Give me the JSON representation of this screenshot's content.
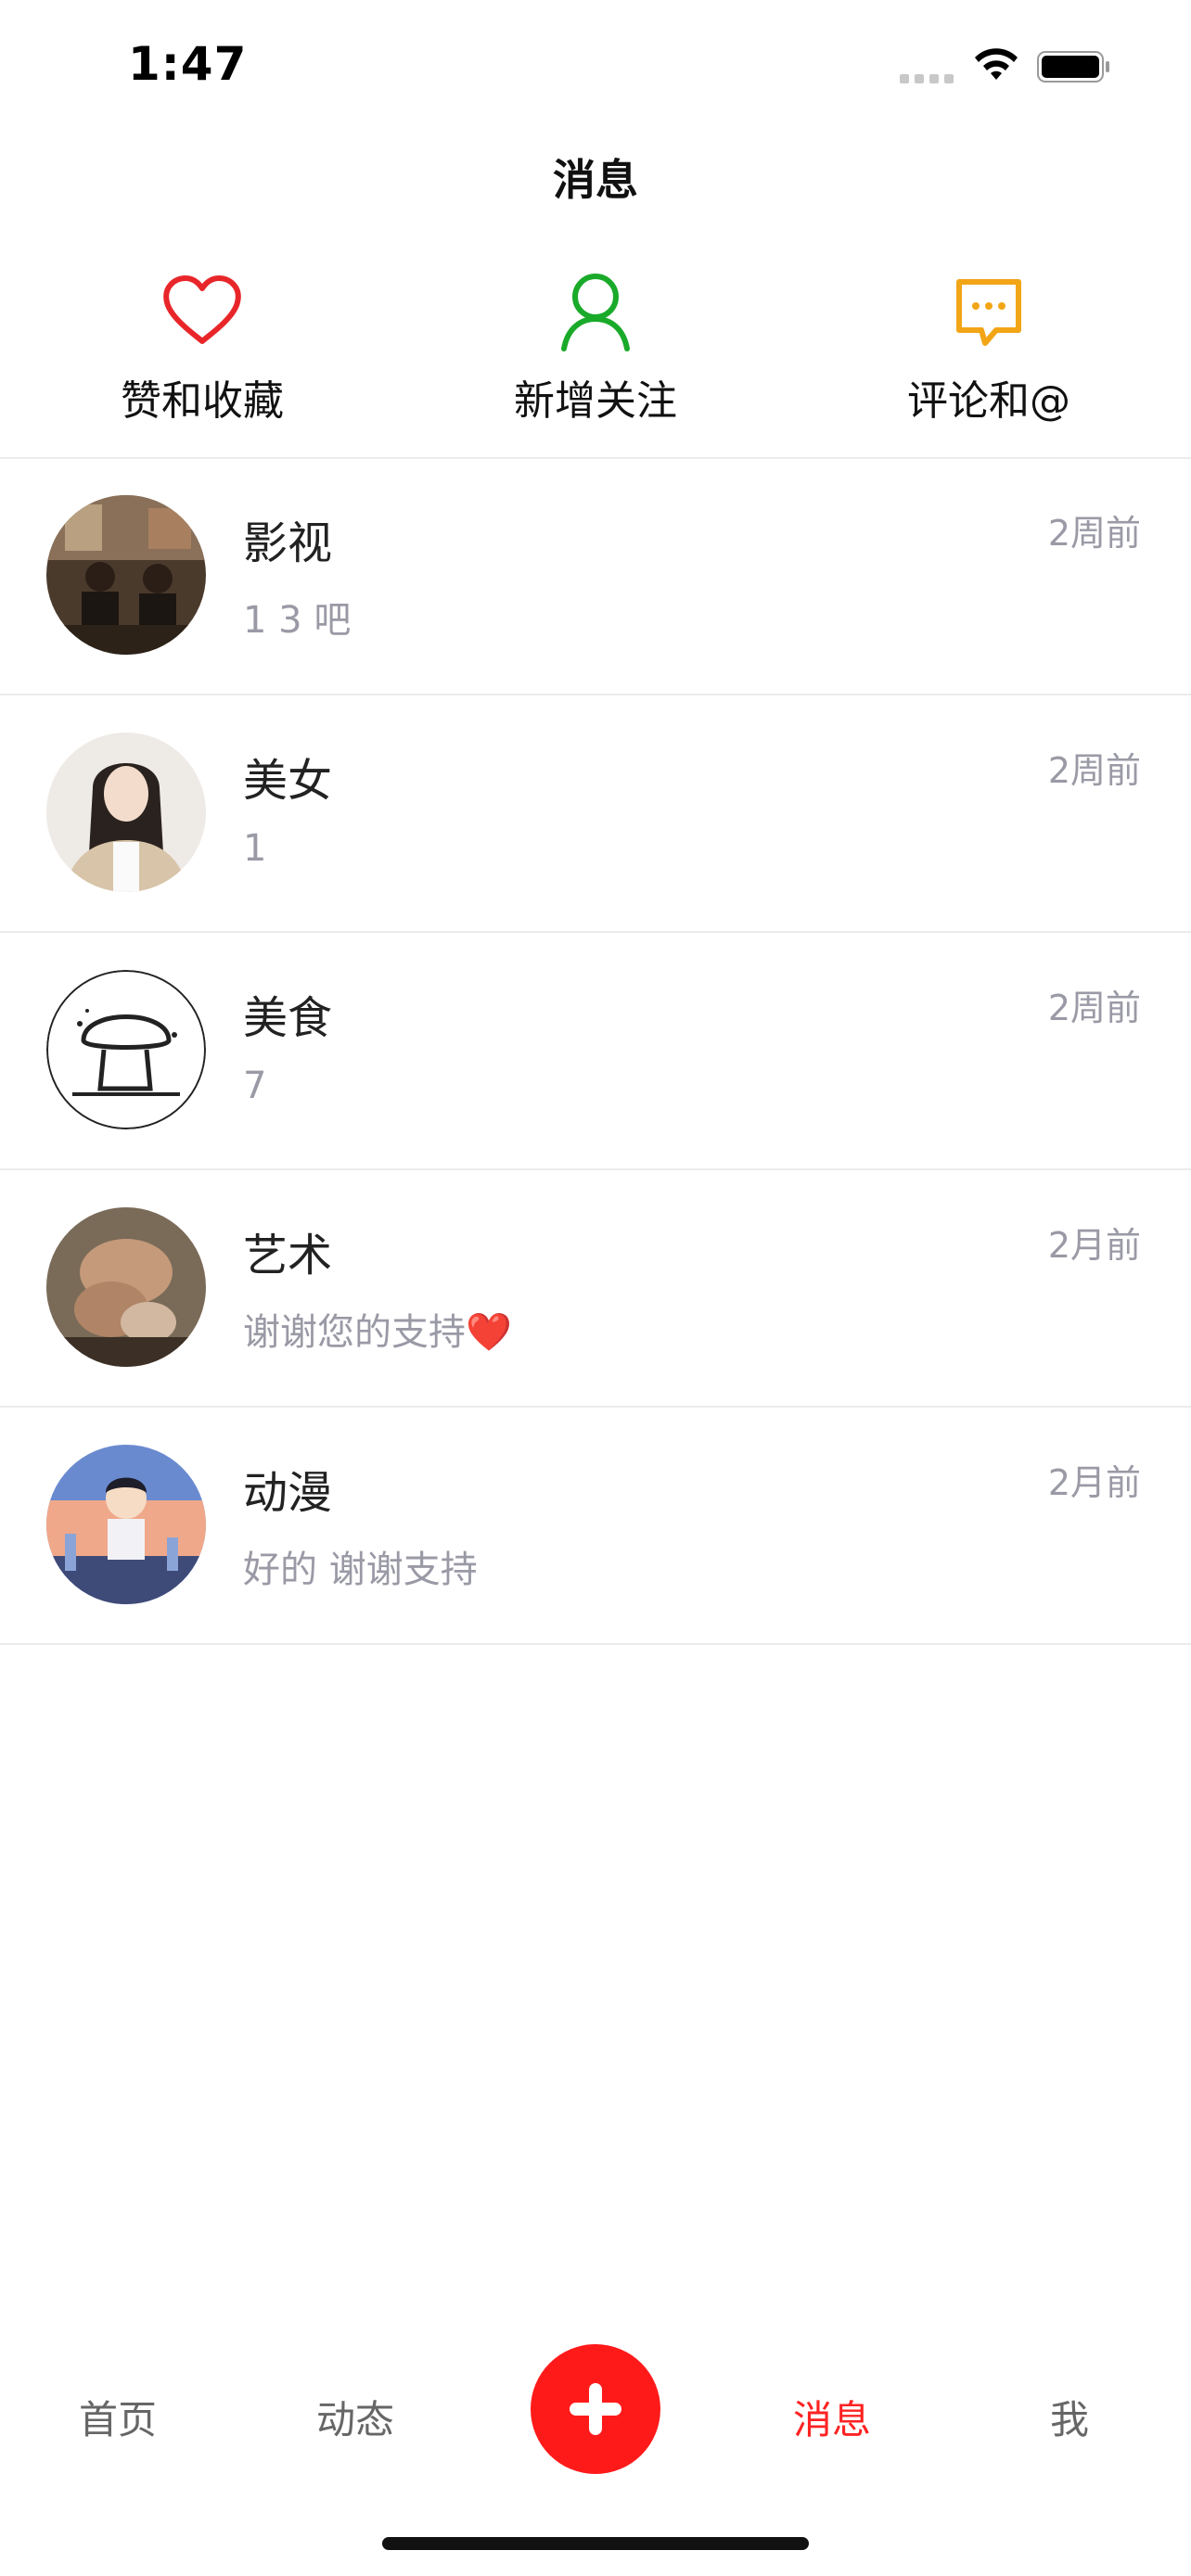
{
  "status_bar": {
    "time": "1:47"
  },
  "header": {
    "title": "消息"
  },
  "categories": [
    {
      "label": "赞和收藏",
      "icon": "heart-icon",
      "color": "#e8262a"
    },
    {
      "label": "新增关注",
      "icon": "person-icon",
      "color": "#1aaa2a"
    },
    {
      "label": "评论和@",
      "icon": "comment-icon",
      "color": "#f2a516"
    }
  ],
  "messages": [
    {
      "title": "影视",
      "preview": "1 3 吧",
      "time": "2周前",
      "avatar": "movie-avatar"
    },
    {
      "title": "美女",
      "preview": "1",
      "time": "2周前",
      "avatar": "woman-avatar"
    },
    {
      "title": "美食",
      "preview": "7",
      "time": "2周前",
      "avatar": "mushroom-avatar"
    },
    {
      "title": "艺术",
      "preview": "谢谢您的支持❤️",
      "time": "2月前",
      "avatar": "art-avatar"
    },
    {
      "title": "动漫",
      "preview": "好的 谢谢支持",
      "time": "2月前",
      "avatar": "anime-avatar"
    }
  ],
  "tab_bar": {
    "items": [
      {
        "label": "首页"
      },
      {
        "label": "动态"
      },
      {
        "label": "消息",
        "active": true
      },
      {
        "label": "我"
      }
    ],
    "add_icon": "plus-icon",
    "active_color": "#ff2222",
    "add_button_color": "#ff1a1a"
  }
}
